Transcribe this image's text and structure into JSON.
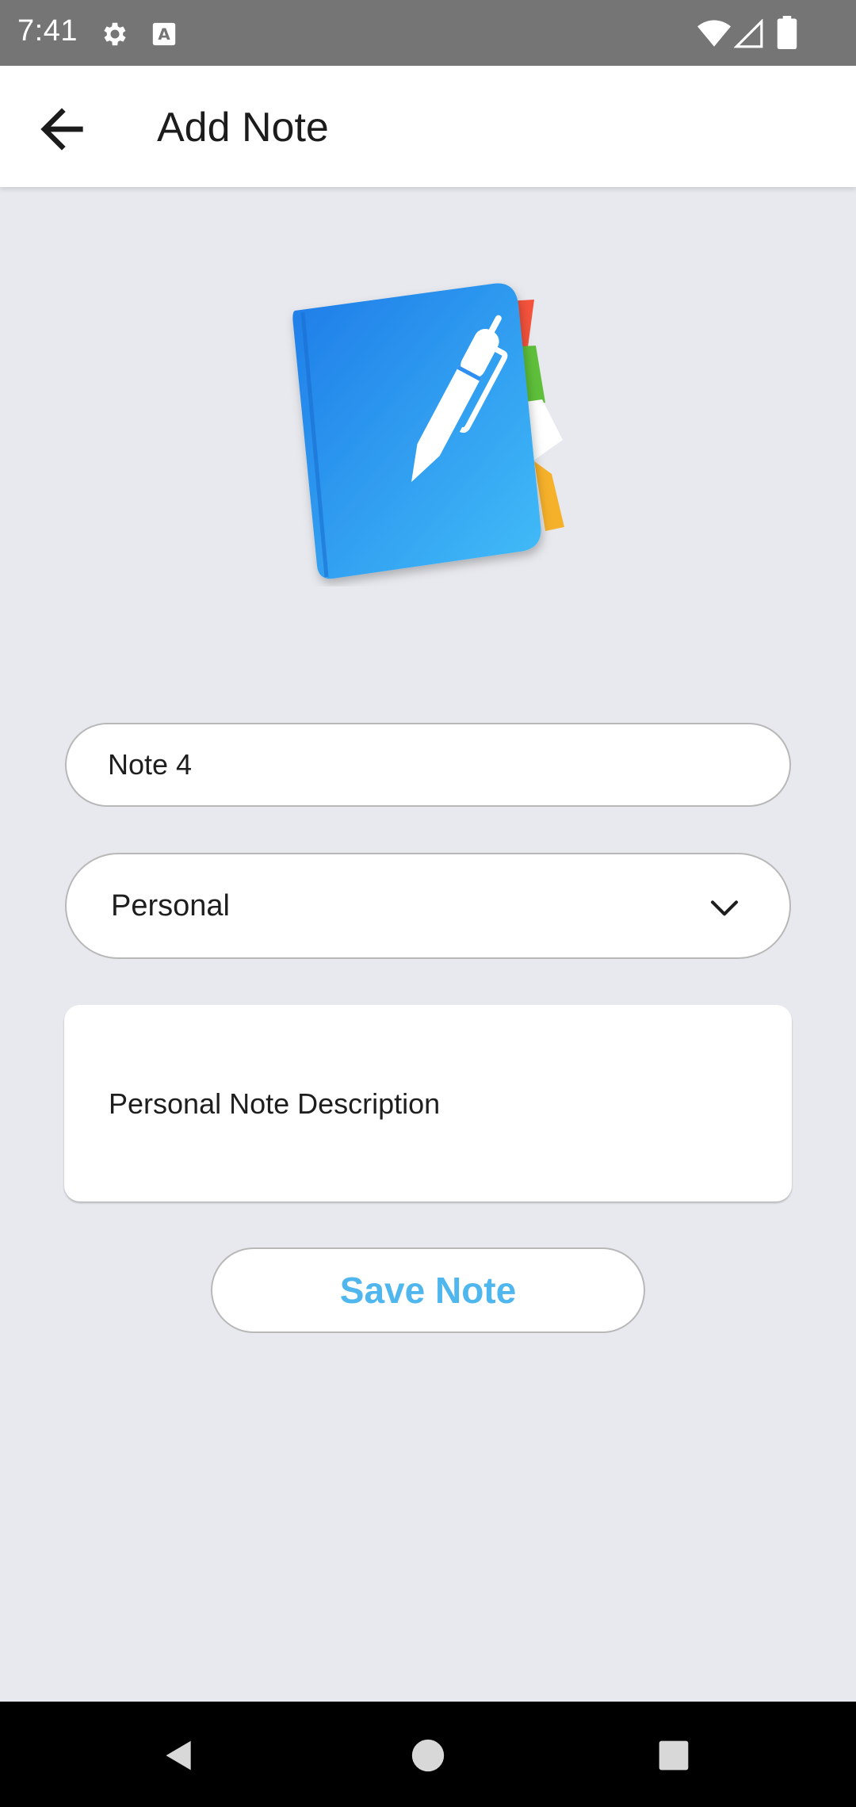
{
  "status_bar": {
    "time": "7:41",
    "icons": [
      "gear-icon",
      "a-box-icon",
      "wifi-icon",
      "signal-icon",
      "battery-icon"
    ]
  },
  "app_bar": {
    "title": "Add Note",
    "back_icon": "arrow-left-icon"
  },
  "illustration": {
    "icon": "notebook-pen-icon"
  },
  "form": {
    "title_value": "Note 4",
    "category": {
      "selected": "Personal",
      "icon": "chevron-down-icon"
    },
    "description_value": "Personal Note Description",
    "save_label": "Save Note"
  },
  "colors": {
    "background": "#e8e9ee",
    "status_bar": "#757575",
    "accent": "#4fb6ee",
    "notebook_blue": "#2196f3"
  },
  "nav_bar": {
    "icons": [
      "back-triangle-icon",
      "home-circle-icon",
      "recents-square-icon"
    ]
  }
}
